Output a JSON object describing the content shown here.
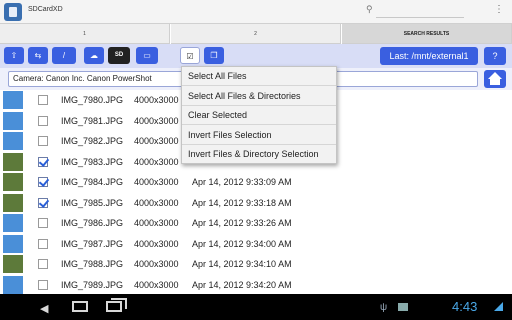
{
  "app": {
    "title": "SDCardXD"
  },
  "actionbar": {
    "search_icon": "search-icon",
    "overflow_icon": "overflow-menu-icon",
    "search_glyph": "⚲",
    "overflow_glyph": "⋮"
  },
  "tabs": [
    {
      "label": "1"
    },
    {
      "label": "2"
    },
    {
      "label": "SEARCH RESULTS"
    }
  ],
  "toolbar": {
    "buttons": [
      {
        "name": "go-up-button",
        "icon": "go-up-arrow-icon",
        "glyph": "⇧",
        "style": "blue"
      },
      {
        "name": "swap-button",
        "icon": "swap-icon",
        "glyph": "⇆",
        "style": "blue"
      },
      {
        "name": "root-button",
        "icon": "slash-icon",
        "glyph": "/",
        "style": "blue"
      },
      {
        "name": "network-button",
        "icon": "network-icon",
        "glyph": "☁",
        "style": "blue"
      },
      {
        "name": "sd-button",
        "icon": "sd-card-icon",
        "glyph": "SD",
        "style": "dark"
      },
      {
        "name": "card-reader-button",
        "icon": "card-reader-icon",
        "glyph": "▭",
        "style": "blue"
      },
      {
        "name": "select-button",
        "icon": "checkbox-icon",
        "glyph": "☑",
        "style": "light"
      },
      {
        "name": "copy-button",
        "icon": "copy-icon",
        "glyph": "❐",
        "style": "blue"
      }
    ],
    "last_label": "Last: /mnt/external1",
    "help_label": "?"
  },
  "path": {
    "value": "Camera: Canon Inc. Canon PowerShot",
    "home_icon": "home-icon"
  },
  "menu": {
    "items": [
      "Select All Files",
      "Select All Files & Directories",
      "Clear Selected",
      "Invert Files Selection",
      "Invert Files & Directory Selection"
    ]
  },
  "files": [
    {
      "name": "IMG_7980.JPG",
      "dims": "4000x3000",
      "date": "",
      "checked": false,
      "thumb": "blue"
    },
    {
      "name": "IMG_7981.JPG",
      "dims": "4000x3000",
      "date": "",
      "checked": false,
      "thumb": "blue"
    },
    {
      "name": "IMG_7982.JPG",
      "dims": "4000x3000",
      "date": "",
      "checked": false,
      "thumb": "blue"
    },
    {
      "name": "IMG_7983.JPG",
      "dims": "4000x3000",
      "date": "",
      "checked": true,
      "thumb": "green"
    },
    {
      "name": "IMG_7984.JPG",
      "dims": "4000x3000",
      "date": "Apr 14, 2012 9:33:09 AM",
      "checked": true,
      "thumb": "green"
    },
    {
      "name": "IMG_7985.JPG",
      "dims": "4000x3000",
      "date": "Apr 14, 2012 9:33:18 AM",
      "checked": true,
      "thumb": "green"
    },
    {
      "name": "IMG_7986.JPG",
      "dims": "4000x3000",
      "date": "Apr 14, 2012 9:33:26 AM",
      "checked": false,
      "thumb": "blue"
    },
    {
      "name": "IMG_7987.JPG",
      "dims": "4000x3000",
      "date": "Apr 14, 2012 9:34:00 AM",
      "checked": false,
      "thumb": "blue"
    },
    {
      "name": "IMG_7988.JPG",
      "dims": "4000x3000",
      "date": "Apr 14, 2012 9:34:10 AM",
      "checked": false,
      "thumb": "green"
    },
    {
      "name": "IMG_7989.JPG",
      "dims": "4000x3000",
      "date": "Apr 14, 2012 9:34:20 AM",
      "checked": false,
      "thumb": "blue"
    }
  ],
  "statusbar": {
    "time": "4:43",
    "icons": [
      "back-icon",
      "home-icon",
      "recent-apps-icon",
      "usb-icon",
      "gallery-icon",
      "signal-icon"
    ]
  },
  "colors": {
    "accent": "#3a5fe0",
    "toolbar_bg": "#d8ddf6",
    "clock": "#4aa8e8"
  }
}
